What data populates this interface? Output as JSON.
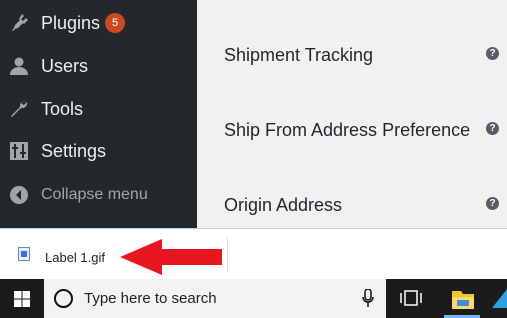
{
  "sidebar": {
    "items": [
      {
        "label": "Plugins",
        "icon": "plugin-icon",
        "badge": "5"
      },
      {
        "label": "Users",
        "icon": "users-icon"
      },
      {
        "label": "Tools",
        "icon": "wrench-icon"
      },
      {
        "label": "Settings",
        "icon": "settings-sliders-icon"
      },
      {
        "label": "Collapse menu",
        "icon": "collapse-arrow-icon"
      }
    ]
  },
  "settings": {
    "rows": [
      {
        "label": "Shipment Tracking",
        "help": "?"
      },
      {
        "label": "Ship From Address Preference",
        "help": "?"
      },
      {
        "label": "Origin Address",
        "help": "?"
      }
    ]
  },
  "downloads": {
    "file_name": "Label 1.gif",
    "file_icon": "gif-file-icon",
    "annotation": "red-arrow",
    "annotation_color": "#e8161f"
  },
  "taskbar": {
    "search_placeholder": "Type here to search",
    "icons": [
      "windows-start-icon",
      "cortana-search-icon",
      "microphone-icon",
      "task-view-icon",
      "file-explorer-icon"
    ]
  },
  "colors": {
    "sidebar_bg": "#23282d",
    "badge": "#ca4a1f",
    "content_bg": "#f1f1f1",
    "taskbar_bg": "#1b1b1b"
  }
}
